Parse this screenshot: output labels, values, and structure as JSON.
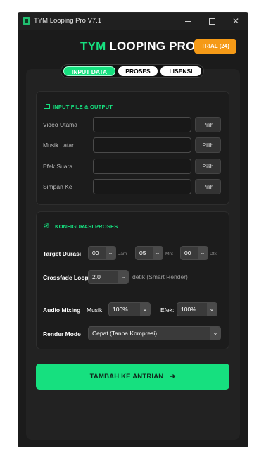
{
  "window": {
    "title": "TYM Looping Pro V7.1"
  },
  "brand": {
    "part1": "TYM",
    "part2": " LOOPING PRO",
    "trial_badge": "TRIAL (24)"
  },
  "tabs": [
    {
      "label": "INPUT DATA",
      "active": true
    },
    {
      "label": "PROSES",
      "active": false
    },
    {
      "label": "LISENSI",
      "active": false
    }
  ],
  "input_section": {
    "title": "INPUT FILE & OUTPUT",
    "rows": [
      {
        "label": "Video Utama",
        "value": "",
        "button": "Pilih"
      },
      {
        "label": "Musik Latar",
        "value": "",
        "button": "Pilih"
      },
      {
        "label": "Efek Suara",
        "value": "",
        "button": "Pilih"
      },
      {
        "label": "Simpan Ke",
        "value": "",
        "button": "Pilih"
      }
    ]
  },
  "config_section": {
    "title": "KONFIGURASI PROSES",
    "target_duration": {
      "label": "Target Durasi",
      "hours": "00",
      "hours_unit": "Jam",
      "minutes": "05",
      "minutes_unit": "Mnt",
      "seconds": "00",
      "seconds_unit": "Dtk"
    },
    "crossfade": {
      "label": "Crossfade Loop",
      "value": "2.0",
      "hint": "detik (Smart Render)"
    },
    "audio_mixing": {
      "label": "Audio Mixing",
      "music_label": "Musik:",
      "music_value": "100%",
      "effect_label": "Efek:",
      "effect_value": "100%"
    },
    "render_mode": {
      "label": "Render Mode",
      "value": "Cepat (Tanpa Kompresi)"
    }
  },
  "action": {
    "label": "TAMBAH KE ANTRIAN",
    "arrow": "➔"
  },
  "colors": {
    "accent": "#16e07f",
    "badge": "#f59a17",
    "background": "#1b1b1b"
  }
}
